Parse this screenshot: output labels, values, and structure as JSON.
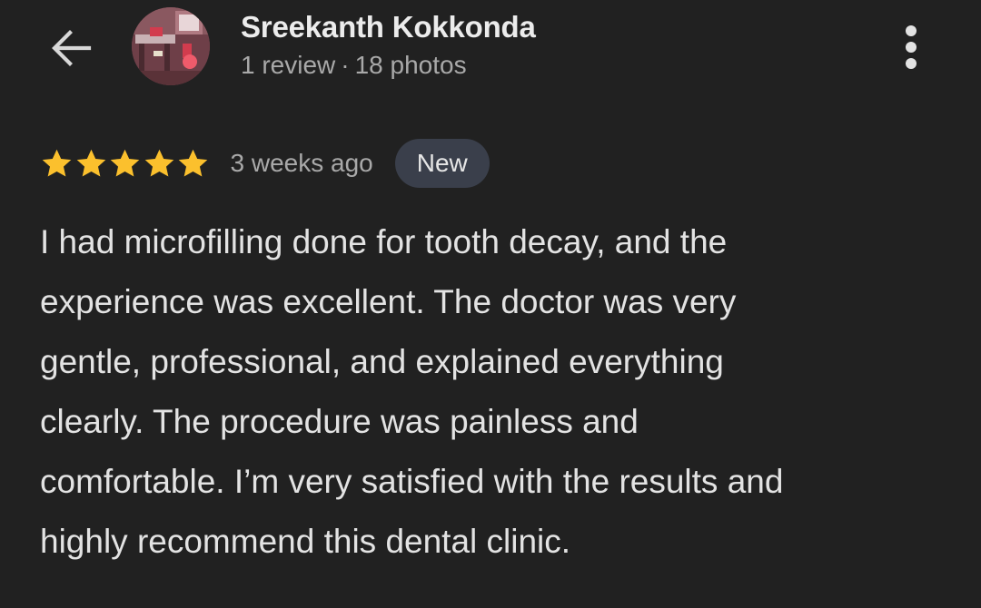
{
  "header": {
    "back_icon": "arrow-back-icon",
    "avatar_icon": "profile-photo",
    "user_name": "Sreekanth Kokkonda",
    "review_count": "1 review",
    "separator": "·",
    "photo_count": "18 photos",
    "more_icon": "more-vertical-icon"
  },
  "review": {
    "rating": 5,
    "rating_max": 5,
    "star_color": "#fbc02d",
    "date": "3 weeks ago",
    "badge": "New",
    "text": "I had microfilling done for tooth decay, and the\nexperience was excellent. The doctor was very\ngentle, professional, and explained everything\nclearly. The procedure was painless and\ncomfortable. I’m very satisfied with the results and\nhighly recommend this dental clinic."
  },
  "colors": {
    "background": "#212121",
    "primary_text": "#e3e3e3",
    "secondary_text": "#a9a9a9",
    "badge_background": "#3a3f4b"
  }
}
